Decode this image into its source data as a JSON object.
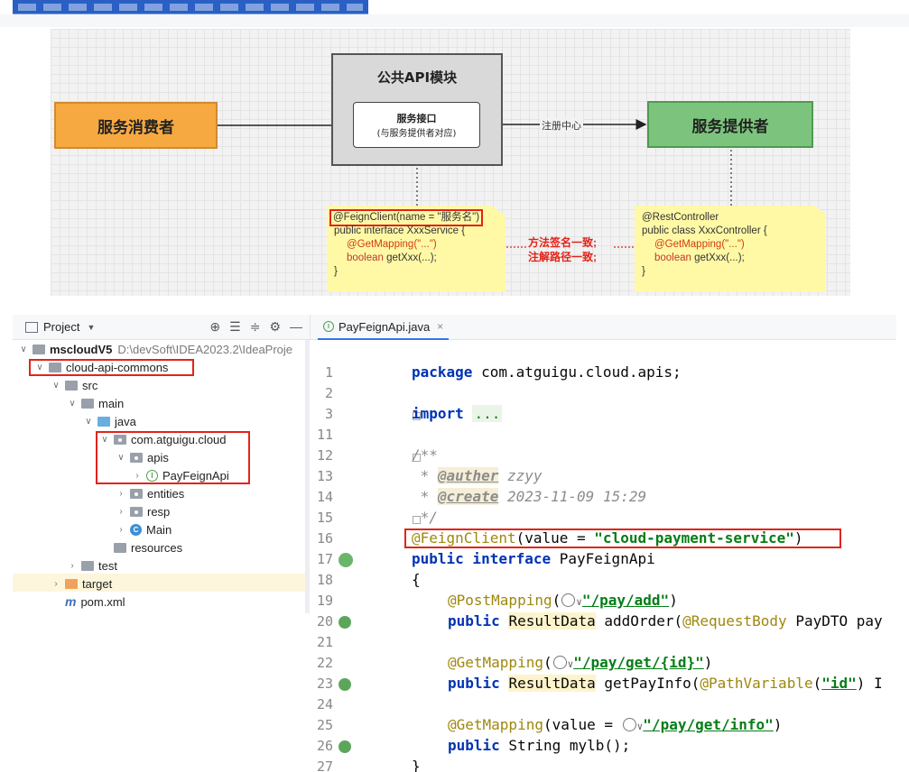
{
  "diagram": {
    "module_title": "公共API模块",
    "consumer": "服务消费者",
    "provider": "服务提供者",
    "interface_title": "服务接口",
    "interface_sub": "(与服务提供者对应)",
    "registry_label": "注册中心",
    "note_left": {
      "line1": "@FeignClient(name = \"服务名\")",
      "line2": "public interface XxxService {",
      "line3_anno": "@GetMapping(\"...\")",
      "line4_kw": "boolean",
      "line4_rest": " getXxx(...);",
      "line5": "}"
    },
    "note_right": {
      "line1": "@RestController",
      "line2": "public class XxxController {",
      "line3_anno": "@GetMapping(\"...\")",
      "line4_kw": "boolean",
      "line4_rest": " getXxx(...);",
      "line5": "}"
    },
    "mid_text_1": "方法签名一致;",
    "mid_text_2": "注解路径一致;",
    "colors": {
      "consumer": "#f7a941",
      "provider": "#7cc47d",
      "highlight": "#e2231a"
    }
  },
  "ide": {
    "project_panel_title": "Project",
    "tree": [
      {
        "label": "mscloudV5",
        "path": "D:\\devSoft\\IDEA2023.2\\IdeaProje"
      },
      {
        "label": "cloud-api-commons"
      },
      {
        "label": "src"
      },
      {
        "label": "main"
      },
      {
        "label": "java"
      },
      {
        "label": "com.atguigu.cloud"
      },
      {
        "label": "apis"
      },
      {
        "label": "PayFeignApi"
      },
      {
        "label": "entities"
      },
      {
        "label": "resp"
      },
      {
        "label": "Main"
      },
      {
        "label": "resources"
      },
      {
        "label": "test"
      },
      {
        "label": "target"
      },
      {
        "label": "pom.xml"
      }
    ],
    "editor_tab": "PayFeignApi.java",
    "line_numbers": [
      "1",
      "2",
      "3",
      "11",
      "12",
      "13",
      "14",
      "15",
      "16",
      "17",
      "18",
      "19",
      "20",
      "21",
      "22",
      "23",
      "24",
      "25",
      "26",
      "27"
    ],
    "code": {
      "pkg_kw": "package",
      "pkg_name": " com.atguigu.cloud.apis;",
      "import_kw": "import",
      "import_dots": "...",
      "doc_open": "/**",
      "doc_author_tag": "@auther",
      "doc_author_val": " zzyy",
      "doc_create_tag": "@create",
      "doc_create_val": " 2023-11-09 15:29",
      "doc_close": " */",
      "feign_anno": "@FeignClient",
      "feign_pre": "(value = ",
      "feign_str": "\"cloud-payment-service\"",
      "feign_post": ")",
      "iface_kw": "public interface",
      "iface_name": " PayFeignApi",
      "brace_open": "{",
      "post_anno": "@PostMapping",
      "post_url": "\"/pay/add\"",
      "add_kw": "public",
      "add_type": "ResultData",
      "add_rest": " addOrder(",
      "add_param_anno": "@RequestBody",
      "add_param_rest": " PayDTO pay",
      "get_anno": "@GetMapping",
      "get_url": "\"/pay/get/{id}\"",
      "info_kw": "public",
      "info_type": "ResultData",
      "info_rest": " getPayInfo(",
      "info_param_anno": "@PathVariable",
      "info_param_str": "\"id\"",
      "info_param_rest": ") I",
      "lb_anno": "@GetMapping",
      "lb_pre": "(value = ",
      "lb_url": "\"/pay/get/info\"",
      "lb_kw": "public",
      "lb_rest": " String mylb();",
      "brace_close": "}"
    }
  }
}
